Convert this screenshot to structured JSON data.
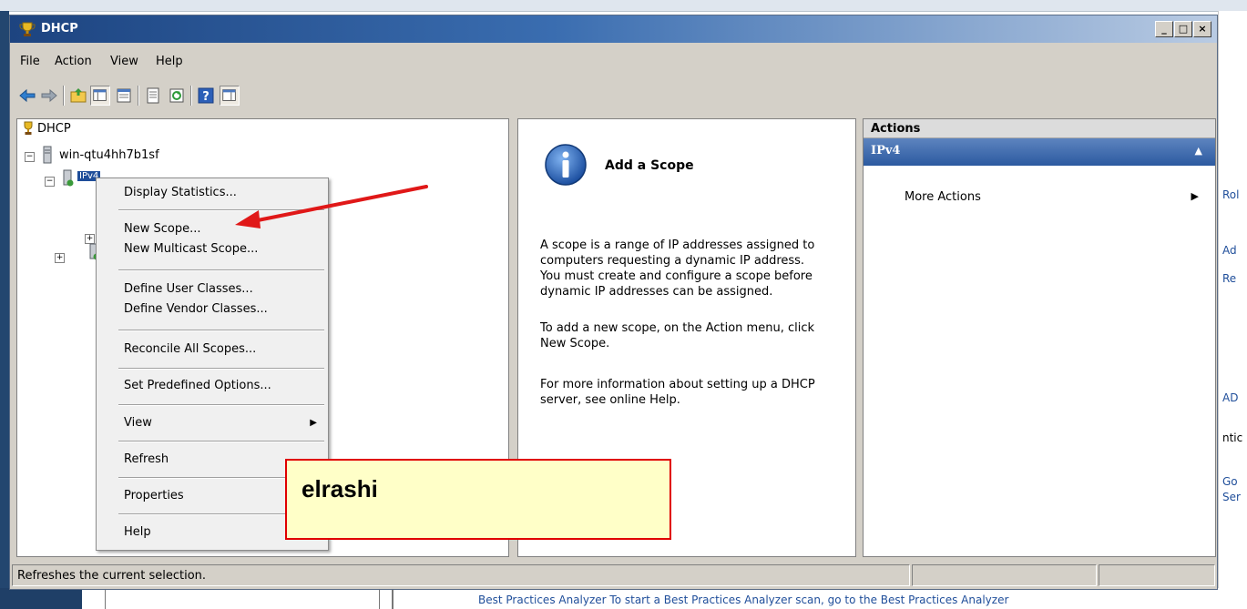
{
  "window": {
    "title": "DHCP"
  },
  "title_buttons": {
    "minimize": "_",
    "maximize": "□",
    "close": "×"
  },
  "menubar": [
    "File",
    "Action",
    "View",
    "Help"
  ],
  "tree": {
    "root": "DHCP",
    "server": "win-qtu4hh7b1sf",
    "selected": "IPv4",
    "expanders": {
      "server": "−",
      "ipv4": "−",
      "child": "+",
      "ipv6": "+"
    }
  },
  "context_menu": {
    "items": [
      "Display Statistics...",
      "New Scope...",
      "New Multicast Scope...",
      "Define User Classes...",
      "Define Vendor Classes...",
      "Reconcile All Scopes...",
      "Set Predefined Options...",
      "View",
      "Refresh",
      "Properties",
      "Help"
    ]
  },
  "description": {
    "title": "Add a Scope",
    "icon": "info-icon",
    "paragraphs": [
      "A scope is a range of IP addresses assigned to computers requesting a dynamic IP address. You must create and configure a scope before dynamic IP addresses can be assigned.",
      "To add a new scope, on the Action menu, click New Scope.",
      "For more information about setting up a DHCP server, see online Help."
    ]
  },
  "actions": {
    "header": "Actions",
    "section": "IPv4",
    "items": [
      "More Actions"
    ]
  },
  "statusbar": {
    "text": "Refreshes the current selection."
  },
  "annotation": {
    "text": "elrashi",
    "border_color": "#e00000",
    "fill_color": "#ffffc8"
  },
  "background": {
    "right_fragments": [
      "Rol",
      "Ad",
      "Re",
      "AD",
      "ntic",
      "Go",
      "Ser"
    ],
    "bottom_fragment": "Best Practices Analyzer   To start a Best Practices Analyzer scan, go to the Best Practices Analyzer"
  },
  "colors": {
    "titlebar": "#1d4480",
    "actions_accent": "#2c5aa0",
    "chrome": "#d4d0c8"
  }
}
